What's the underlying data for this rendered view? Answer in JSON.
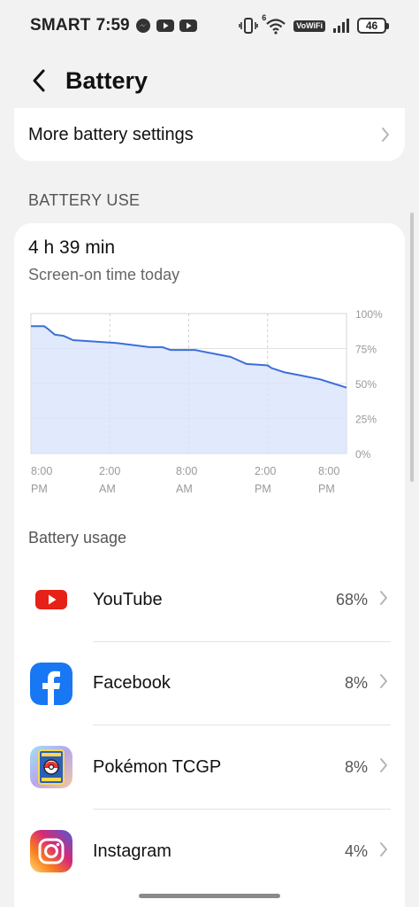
{
  "status_bar": {
    "carrier": "SMART",
    "time": "7:59",
    "vowifi": "VoWiFi",
    "battery": "46",
    "wifi_badge": "6"
  },
  "header": {
    "title": "Battery",
    "back_icon": "chevron-left-icon"
  },
  "more_settings": {
    "label": "More battery settings"
  },
  "battery_use": {
    "section_title": "BATTERY USE",
    "screen_on_value": "4 h 39 min",
    "screen_on_label": "Screen-on time today"
  },
  "chart_data": {
    "type": "area",
    "title": "",
    "xlabel": "",
    "ylabel": "",
    "x_tick_labels": [
      [
        "8:00",
        "PM"
      ],
      [
        "2:00",
        "AM"
      ],
      [
        "8:00",
        "AM"
      ],
      [
        "2:00",
        "PM"
      ],
      [
        "8:00",
        "PM"
      ]
    ],
    "y_tick_labels": [
      "100%",
      "75%",
      "50%",
      "25%",
      "0%"
    ],
    "ylim": [
      0,
      100
    ],
    "xlim": [
      0,
      24
    ],
    "x_unit": "hours since 8:00 PM",
    "grid": true,
    "series_color": "#3b6fd9",
    "fill_color": "#d9e3fb",
    "x": [
      0,
      1.0,
      1.3,
      1.8,
      2.5,
      3.2,
      6.5,
      9.0,
      10.0,
      10.6,
      12.5,
      13.0,
      15.2,
      16.4,
      18.0,
      18.3,
      19.3,
      20.4,
      22.0,
      23.0,
      23.7,
      24.0
    ],
    "y": [
      91,
      91,
      89,
      85,
      84,
      81,
      79,
      76,
      76,
      74,
      74,
      73,
      69,
      64,
      63,
      61,
      58,
      56,
      53,
      50,
      48,
      47
    ]
  },
  "usage": {
    "title": "Battery usage",
    "apps": [
      {
        "name": "YouTube",
        "percent": "68%",
        "icon": "youtube-icon",
        "color": "#e62117"
      },
      {
        "name": "Facebook",
        "percent": "8%",
        "icon": "facebook-icon",
        "color": "#1877f2"
      },
      {
        "name": "Pokémon TCGP",
        "percent": "8%",
        "icon": "pokemon-tcgp-icon",
        "color": "#6fb5e8"
      },
      {
        "name": "Instagram",
        "percent": "4%",
        "icon": "instagram-icon",
        "color": "#d62976"
      }
    ]
  }
}
